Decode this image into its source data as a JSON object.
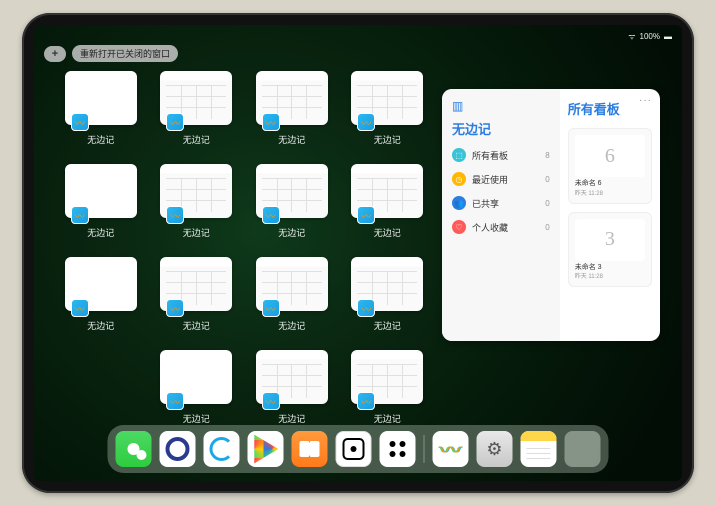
{
  "status": {
    "battery": "100%",
    "signal": "●●●"
  },
  "topbar": {
    "plus": "+",
    "reopen_label": "重新打开已关闭的窗口"
  },
  "grid": {
    "app_label": "无边记",
    "cells": [
      {
        "style": "blank"
      },
      {
        "style": "cal"
      },
      {
        "style": "cal"
      },
      {
        "style": "cal"
      },
      {
        "style": "blank"
      },
      {
        "style": "cal"
      },
      {
        "style": "cal"
      },
      {
        "style": "cal"
      },
      {
        "style": "blank"
      },
      {
        "style": "cal"
      },
      {
        "style": "cal"
      },
      {
        "style": "cal"
      },
      {
        "style": "hidden"
      },
      {
        "style": "blank"
      },
      {
        "style": "cal"
      },
      {
        "style": "cal"
      }
    ]
  },
  "big_window": {
    "menu": "···",
    "left_title": "无边记",
    "right_title": "所有看板",
    "items": [
      {
        "icon": "⬚",
        "label": "所有看板",
        "count": "8"
      },
      {
        "icon": "◷",
        "label": "最近使用",
        "count": "0"
      },
      {
        "icon": "👥",
        "label": "已共享",
        "count": "0"
      },
      {
        "icon": "♡",
        "label": "个人收藏",
        "count": "0"
      }
    ],
    "boards": [
      {
        "sketch": "6",
        "name": "未命名 6",
        "time": "昨天 11:28"
      },
      {
        "sketch": "3",
        "name": "未命名 3",
        "time": "昨天 11:28"
      }
    ]
  },
  "dock": {
    "apps": [
      "wechat",
      "quark",
      "ali",
      "play",
      "books",
      "dot",
      "clover"
    ],
    "recent": [
      "freeform",
      "settings",
      "notes",
      "multi"
    ]
  }
}
